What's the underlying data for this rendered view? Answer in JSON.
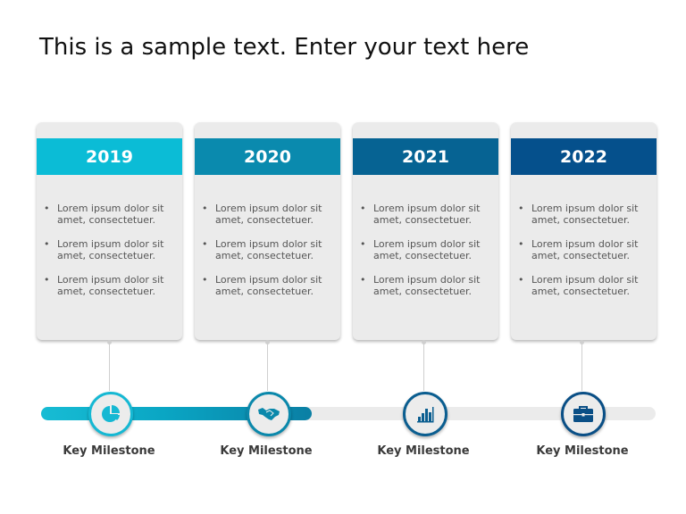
{
  "title": "This is a sample text. Enter your text here",
  "cards": [
    {
      "year": "2019",
      "color": "#0bbcd6",
      "bullets": [
        "Lorem ipsum dolor sit amet, consectetuer.",
        "Lorem ipsum dolor sit amet, consectetuer.",
        "Lorem ipsum dolor sit amet, consectetuer."
      ]
    },
    {
      "year": "2020",
      "color": "#0a8aae",
      "bullets": [
        "Lorem ipsum dolor sit amet, consectetuer.",
        "Lorem ipsum dolor sit amet, consectetuer.",
        "Lorem ipsum dolor sit amet, consectetuer."
      ]
    },
    {
      "year": "2021",
      "color": "#066393",
      "bullets": [
        "Lorem ipsum dolor sit amet, consectetuer.",
        "Lorem ipsum dolor sit amet, consectetuer.",
        "Lorem ipsum dolor sit amet, consectetuer."
      ]
    },
    {
      "year": "2022",
      "color": "#05508c",
      "bullets": [
        "Lorem ipsum dolor sit amet, consectetuer.",
        "Lorem ipsum dolor sit amet, consectetuer.",
        "Lorem ipsum dolor sit amet, consectetuer."
      ]
    }
  ],
  "bullet_glyph": "•",
  "timeline": {
    "progress_percent": 44,
    "track_color": "#ebebeb",
    "fill_colors": [
      "#17bcd4",
      "#0a7fa4"
    ],
    "milestones": [
      {
        "label": "Key Milestone",
        "icon": "pie-chart-icon",
        "color": "#15b8d3"
      },
      {
        "label": "Key Milestone",
        "icon": "handshake-icon",
        "color": "#0a88ab"
      },
      {
        "label": "Key Milestone",
        "icon": "bar-chart-icon",
        "color": "#0b5e90"
      },
      {
        "label": "Key Milestone",
        "icon": "briefcase-icon",
        "color": "#0a4f86"
      }
    ]
  }
}
